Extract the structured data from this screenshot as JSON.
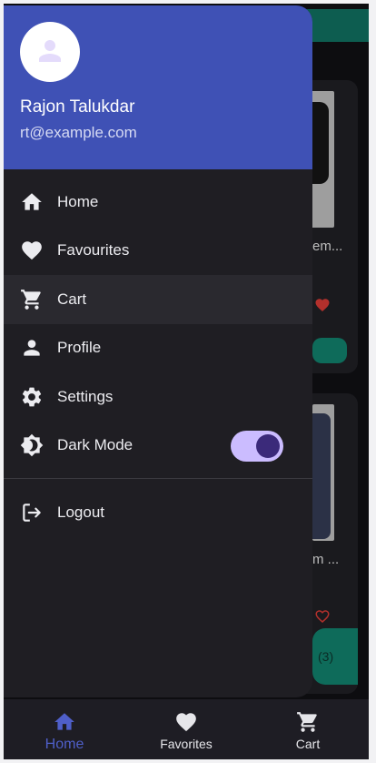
{
  "drawer": {
    "user_name": "Rajon Talukdar",
    "user_email": "rt@example.com",
    "items": [
      {
        "label": "Home",
        "icon": "home-icon"
      },
      {
        "label": "Favourites",
        "icon": "heart-icon"
      },
      {
        "label": "Cart",
        "icon": "cart-icon",
        "selected": true
      },
      {
        "label": "Profile",
        "icon": "person-icon"
      },
      {
        "label": "Settings",
        "icon": "gear-icon"
      },
      {
        "label": "Dark Mode",
        "icon": "brightness-icon",
        "toggle_on": true
      }
    ],
    "logout_label": "Logout"
  },
  "background": {
    "product1_title": "em...",
    "product2_title": "m ...",
    "cart_count": "(3)"
  },
  "bottom_nav": {
    "items": [
      {
        "label": "Home",
        "icon": "home-icon",
        "active": true
      },
      {
        "label": "Favorites",
        "icon": "heart-icon"
      },
      {
        "label": "Cart",
        "icon": "cart-icon"
      }
    ]
  },
  "colors": {
    "drawer_header": "#3f51b5",
    "accent_teal": "#0e6b5a",
    "active_nav": "#4f5fc9",
    "toggle_track": "#cbbcff"
  }
}
